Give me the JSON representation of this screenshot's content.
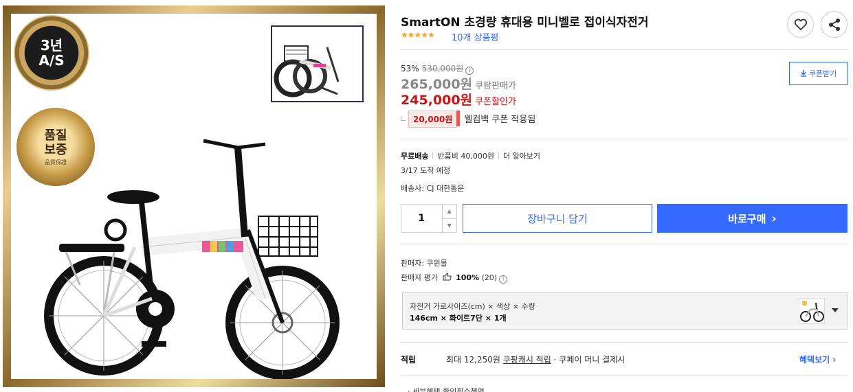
{
  "product_image": {
    "badge_as_line1": "3년",
    "badge_as_line2": "A/S",
    "badge_quality_line1": "품질",
    "badge_quality_line2": "보증",
    "badge_quality_sub": "品質保證"
  },
  "product": {
    "title": "SmartON 초경량 휴대용 미니벨로 접이식자전거",
    "stars": "★★★★★",
    "rating_fraction": 1.0,
    "review_count": "10개 상품평"
  },
  "actions": {
    "favorite_icon": "heart-icon",
    "share_icon": "share-icon"
  },
  "price": {
    "discount_rate": "53%",
    "original_price": "530,000원",
    "info_icon": "i",
    "sale_price": "265,000원",
    "sale_label": "쿠팡판매가",
    "coupon_price": "245,000원",
    "coupon_label": "쿠폰할인가",
    "coupon_button": "쿠폰받기",
    "coupon_amount": "20,000원",
    "coupon_desc": "웰컴백 쿠폰 적용됨"
  },
  "shipping": {
    "free": "무료배송",
    "return_fee": "반품비 40,000원",
    "more": "더 알아보기",
    "eta": "3/17 도착 예정",
    "carrier": "배송사: CJ 대한통운"
  },
  "purchase": {
    "quantity": "1",
    "cart_label": "장바구니 담기",
    "buy_label": "바로구매",
    "buy_arrow": "›"
  },
  "seller": {
    "name": "판매자: 쿠윈몰",
    "rating_label": "판매자 평가",
    "rating_value": "100%",
    "rating_count": "(20)"
  },
  "option": {
    "line1": "자전거 가로사이즈(cm) × 색상 × 수량",
    "line2": "146cm × 화이트7단 × 1개"
  },
  "reward": {
    "label": "적립",
    "text_prefix": "최대 12,250원",
    "cash_link": "쿠팡캐시 적립",
    "text_suffix": "· 쿠페이 머니 결제시",
    "benefit_link": "혜택보기 ›"
  },
  "cutoff_text": "· 세부혜택 확인필수쳉연"
}
